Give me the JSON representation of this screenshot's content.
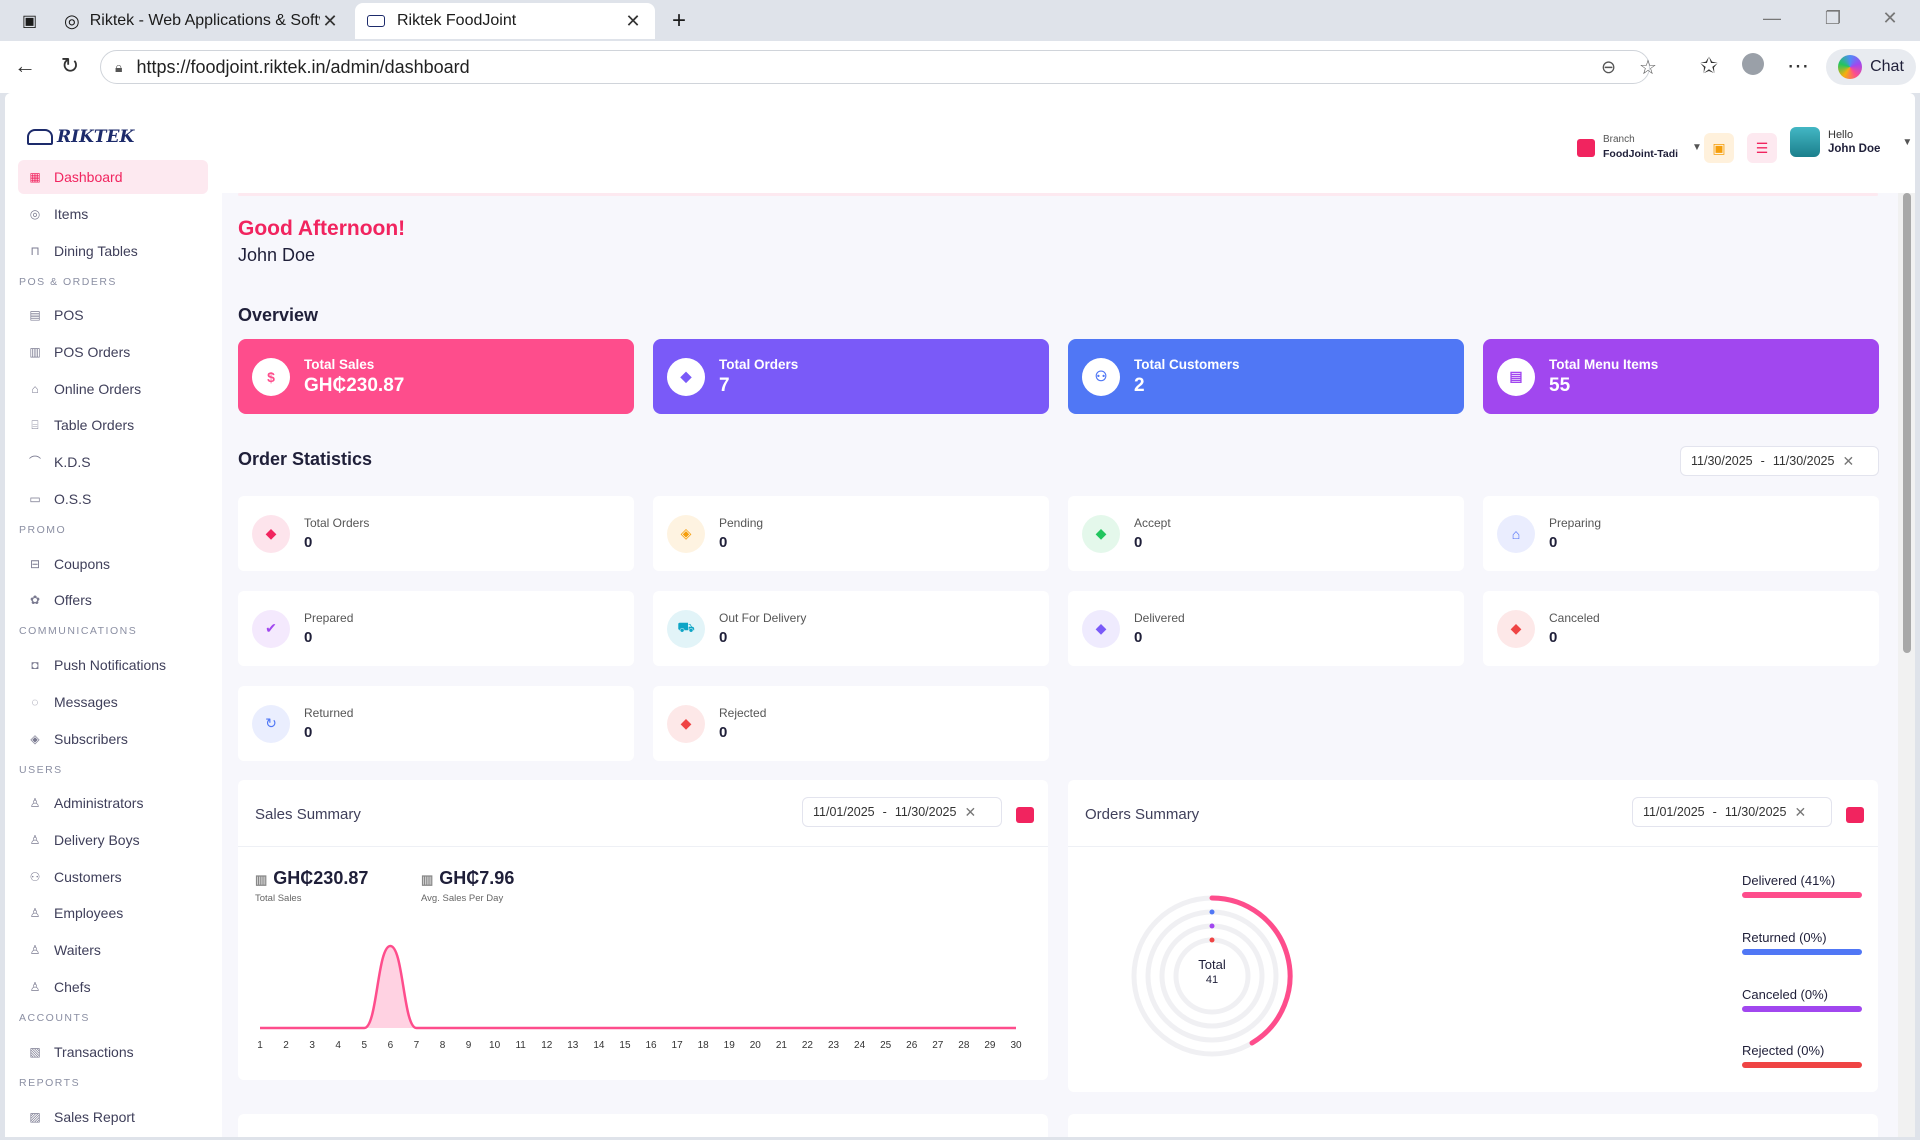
{
  "browser": {
    "tabs": [
      {
        "title": "Riktek - Web Applications & Software"
      },
      {
        "title": "Riktek FoodJoint"
      }
    ],
    "url": "https://foodjoint.riktek.in/admin/dashboard",
    "chat_label": "Chat"
  },
  "brand": {
    "name": "RIKTEK"
  },
  "sidebar": {
    "items": [
      {
        "label": "Dashboard",
        "active": true
      },
      {
        "label": "Items"
      },
      {
        "label": "Dining Tables"
      },
      {
        "label": "POS"
      },
      {
        "label": "POS Orders"
      },
      {
        "label": "Online Orders"
      },
      {
        "label": "Table Orders"
      },
      {
        "label": "K.D.S"
      },
      {
        "label": "O.S.S"
      },
      {
        "label": "Coupons"
      },
      {
        "label": "Offers"
      },
      {
        "label": "Push Notifications"
      },
      {
        "label": "Messages"
      },
      {
        "label": "Subscribers"
      },
      {
        "label": "Administrators"
      },
      {
        "label": "Delivery Boys"
      },
      {
        "label": "Customers"
      },
      {
        "label": "Employees"
      },
      {
        "label": "Waiters"
      },
      {
        "label": "Chefs"
      },
      {
        "label": "Transactions"
      },
      {
        "label": "Sales Report"
      }
    ],
    "headers": [
      "POS & ORDERS",
      "PROMO",
      "COMMUNICATIONS",
      "USERS",
      "ACCOUNTS",
      "REPORTS"
    ]
  },
  "header": {
    "branch_label": "Branch",
    "branch_name": "FoodJoint-Tadi",
    "hello": "Hello",
    "user_name": "John Doe"
  },
  "greeting": {
    "title": "Good Afternoon!",
    "name": "John Doe"
  },
  "overview": {
    "title": "Overview",
    "cards": [
      {
        "label": "Total Sales",
        "value": "GH₵230.87",
        "color": "#fe4d8c"
      },
      {
        "label": "Total Orders",
        "value": "7",
        "color": "#7a5af8"
      },
      {
        "label": "Total Customers",
        "value": "2",
        "color": "#5077f5"
      },
      {
        "label": "Total Menu Items",
        "value": "55",
        "color": "#a147ef"
      }
    ]
  },
  "order_statistics": {
    "title": "Order Statistics",
    "date_from": "11/30/2025",
    "date_to": "11/30/2025",
    "items": [
      {
        "label": "Total Orders",
        "value": "0",
        "color": "#f1245f"
      },
      {
        "label": "Pending",
        "value": "0",
        "color": "#f59e0b"
      },
      {
        "label": "Accept",
        "value": "0",
        "color": "#22c55e"
      },
      {
        "label": "Preparing",
        "value": "0",
        "color": "#4f6ef7"
      },
      {
        "label": "Prepared",
        "value": "0",
        "color": "#a147ef"
      },
      {
        "label": "Out For Delivery",
        "value": "0",
        "color": "#0ea5c6"
      },
      {
        "label": "Delivered",
        "value": "0",
        "color": "#7a5af8"
      },
      {
        "label": "Canceled",
        "value": "0",
        "color": "#ef4444"
      },
      {
        "label": "Returned",
        "value": "0",
        "color": "#5077f5"
      },
      {
        "label": "Rejected",
        "value": "0",
        "color": "#ef4444"
      }
    ]
  },
  "sales_summary": {
    "title": "Sales Summary",
    "date_from": "11/01/2025",
    "date_to": "11/30/2025",
    "total_sales": "GH₵230.87",
    "total_sales_label": "Total Sales",
    "avg_sales": "GH₵7.96",
    "avg_sales_label": "Avg. Sales Per Day"
  },
  "orders_summary": {
    "title": "Orders Summary",
    "date_from": "11/01/2025",
    "date_to": "11/30/2025",
    "total_label": "Total",
    "total_value": "41",
    "legend": [
      {
        "label": "Delivered (41%)",
        "color": "#fe4d8c"
      },
      {
        "label": "Returned (0%)",
        "color": "#5077f5"
      },
      {
        "label": "Canceled (0%)",
        "color": "#a147ef"
      },
      {
        "label": "Rejected (0%)",
        "color": "#ef4444"
      }
    ]
  },
  "chart_data": {
    "type": "area",
    "x": [
      1,
      2,
      3,
      4,
      5,
      6,
      7,
      8,
      9,
      10,
      11,
      12,
      13,
      14,
      15,
      16,
      17,
      18,
      19,
      20,
      21,
      22,
      23,
      24,
      25,
      26,
      27,
      28,
      29,
      30
    ],
    "series": [
      {
        "values": [
          0,
          0,
          0,
          0,
          0,
          230.87,
          0,
          0,
          0,
          0,
          0,
          0,
          0,
          0,
          0,
          0,
          0,
          0,
          0,
          0,
          0,
          0,
          0,
          0,
          0,
          0,
          0,
          0,
          0,
          0
        ]
      }
    ],
    "color": "#fe4d8c"
  }
}
